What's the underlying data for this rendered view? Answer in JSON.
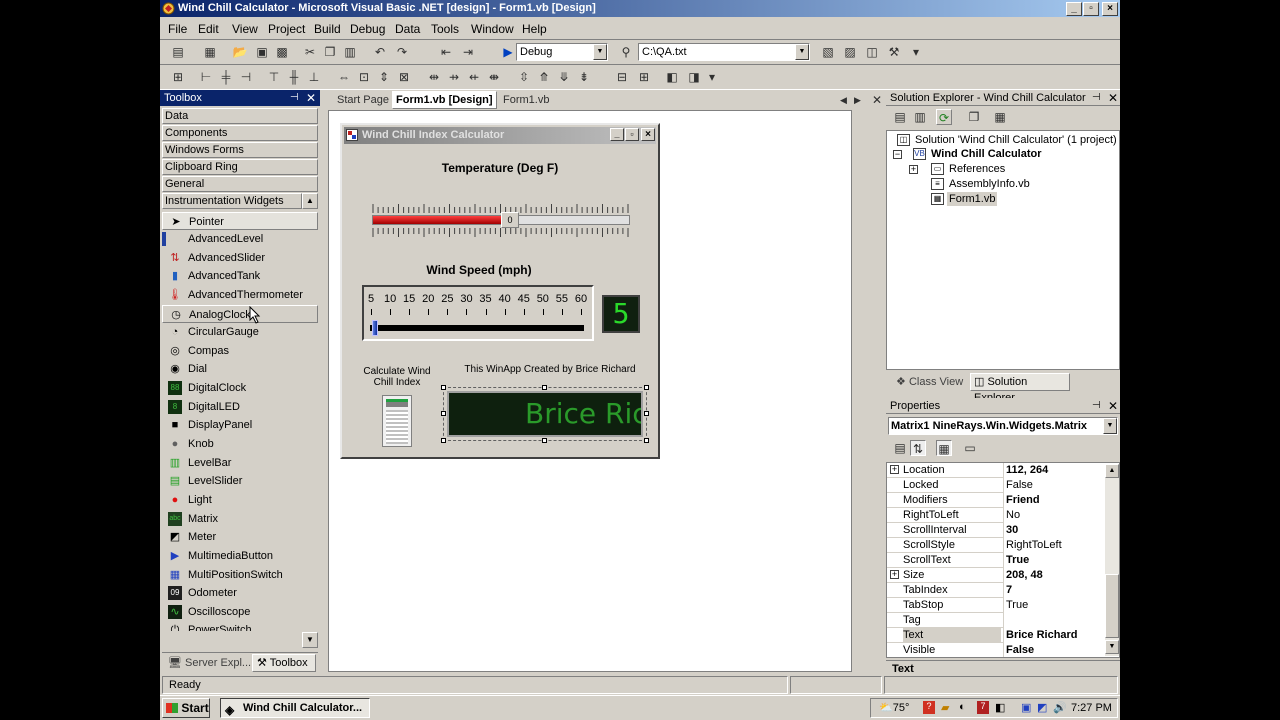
{
  "window": {
    "title": "Wind Chill Calculator - Microsoft Visual Basic .NET [design] - Form1.vb [Design]"
  },
  "menu": [
    "File",
    "Edit",
    "View",
    "Project",
    "Build",
    "Debug",
    "Data",
    "Tools",
    "Window",
    "Help"
  ],
  "toolbar": {
    "config": "Debug",
    "file": "C:\\QA.txt"
  },
  "toolbox": {
    "title": "Toolbox",
    "categories": [
      "Data",
      "Components",
      "Windows Forms",
      "Clipboard Ring",
      "General",
      "Instrumentation Widgets"
    ],
    "items": [
      "Pointer",
      "AdvancedLevel",
      "AdvancedSlider",
      "AdvancedTank",
      "AdvancedThermometer",
      "AnalogClock",
      "CircularGauge",
      "Compas",
      "Dial",
      "DigitalClock",
      "DigitalLED",
      "DisplayPanel",
      "Knob",
      "LevelBar",
      "LevelSlider",
      "Light",
      "Matrix",
      "Meter",
      "MultimediaButton",
      "MultiPositionSwitch",
      "Odometer",
      "Oscilloscope",
      "PowerSwitch"
    ],
    "bottom_tabs": [
      "Server Expl...",
      "Toolbox"
    ]
  },
  "doc_tabs": [
    "Start Page",
    "Form1.vb [Design]",
    "Form1.vb"
  ],
  "form": {
    "title": "Wind Chill Index Calculator",
    "temperature_label": "Temperature (Deg F)",
    "temp_value_text": "0",
    "temp_fill_percent": 52,
    "wind_label": "Wind Speed (mph)",
    "wind_ticks": [
      "5",
      "10",
      "15",
      "20",
      "25",
      "30",
      "35",
      "40",
      "45",
      "50",
      "55",
      "60"
    ],
    "wind_led": "5",
    "calc_label": "Calculate Wind Chill Index",
    "credit": "This WinApp Created by Brice Richard",
    "matrix_text": "Brice Ric"
  },
  "solution_explorer": {
    "title": "Solution Explorer - Wind Chill Calculator",
    "solution": "Solution 'Wind Chill Calculator' (1 project)",
    "project": "Wind Chill Calculator",
    "items": [
      "References",
      "AssemblyInfo.vb",
      "Form1.vb"
    ],
    "tabs": [
      "Class View",
      "Solution Explorer"
    ]
  },
  "properties": {
    "title": "Properties",
    "object": "Matrix1  NineRays.Win.Widgets.Matrix",
    "rows": [
      {
        "name": "Location",
        "value": "112, 264",
        "bold": true
      },
      {
        "name": "Locked",
        "value": "False",
        "bold": false
      },
      {
        "name": "Modifiers",
        "value": "Friend",
        "bold": true
      },
      {
        "name": "RightToLeft",
        "value": "No",
        "bold": false
      },
      {
        "name": "ScrollInterval",
        "value": "30",
        "bold": true
      },
      {
        "name": "ScrollStyle",
        "value": "RightToLeft",
        "bold": false
      },
      {
        "name": "ScrollText",
        "value": "True",
        "bold": true
      },
      {
        "name": "Size",
        "value": "208, 48",
        "bold": true
      },
      {
        "name": "TabIndex",
        "value": "7",
        "bold": true
      },
      {
        "name": "TabStop",
        "value": "True",
        "bold": false
      },
      {
        "name": "Tag",
        "value": "",
        "bold": false
      },
      {
        "name": "Text",
        "value": "Brice Richard",
        "bold": true
      },
      {
        "name": "Visible",
        "value": "False",
        "bold": true
      }
    ],
    "desc": "Text"
  },
  "status": {
    "text": "Ready"
  },
  "taskbar": {
    "start": "Start",
    "task": "Wind Chill Calculator...",
    "temp": "75°",
    "clock": "7:27 PM"
  },
  "colors": {
    "title_active": "#0a246a",
    "title_gradient": "#a6caf0",
    "led_green": "#2ad92a",
    "slider_red": "#d01010"
  }
}
